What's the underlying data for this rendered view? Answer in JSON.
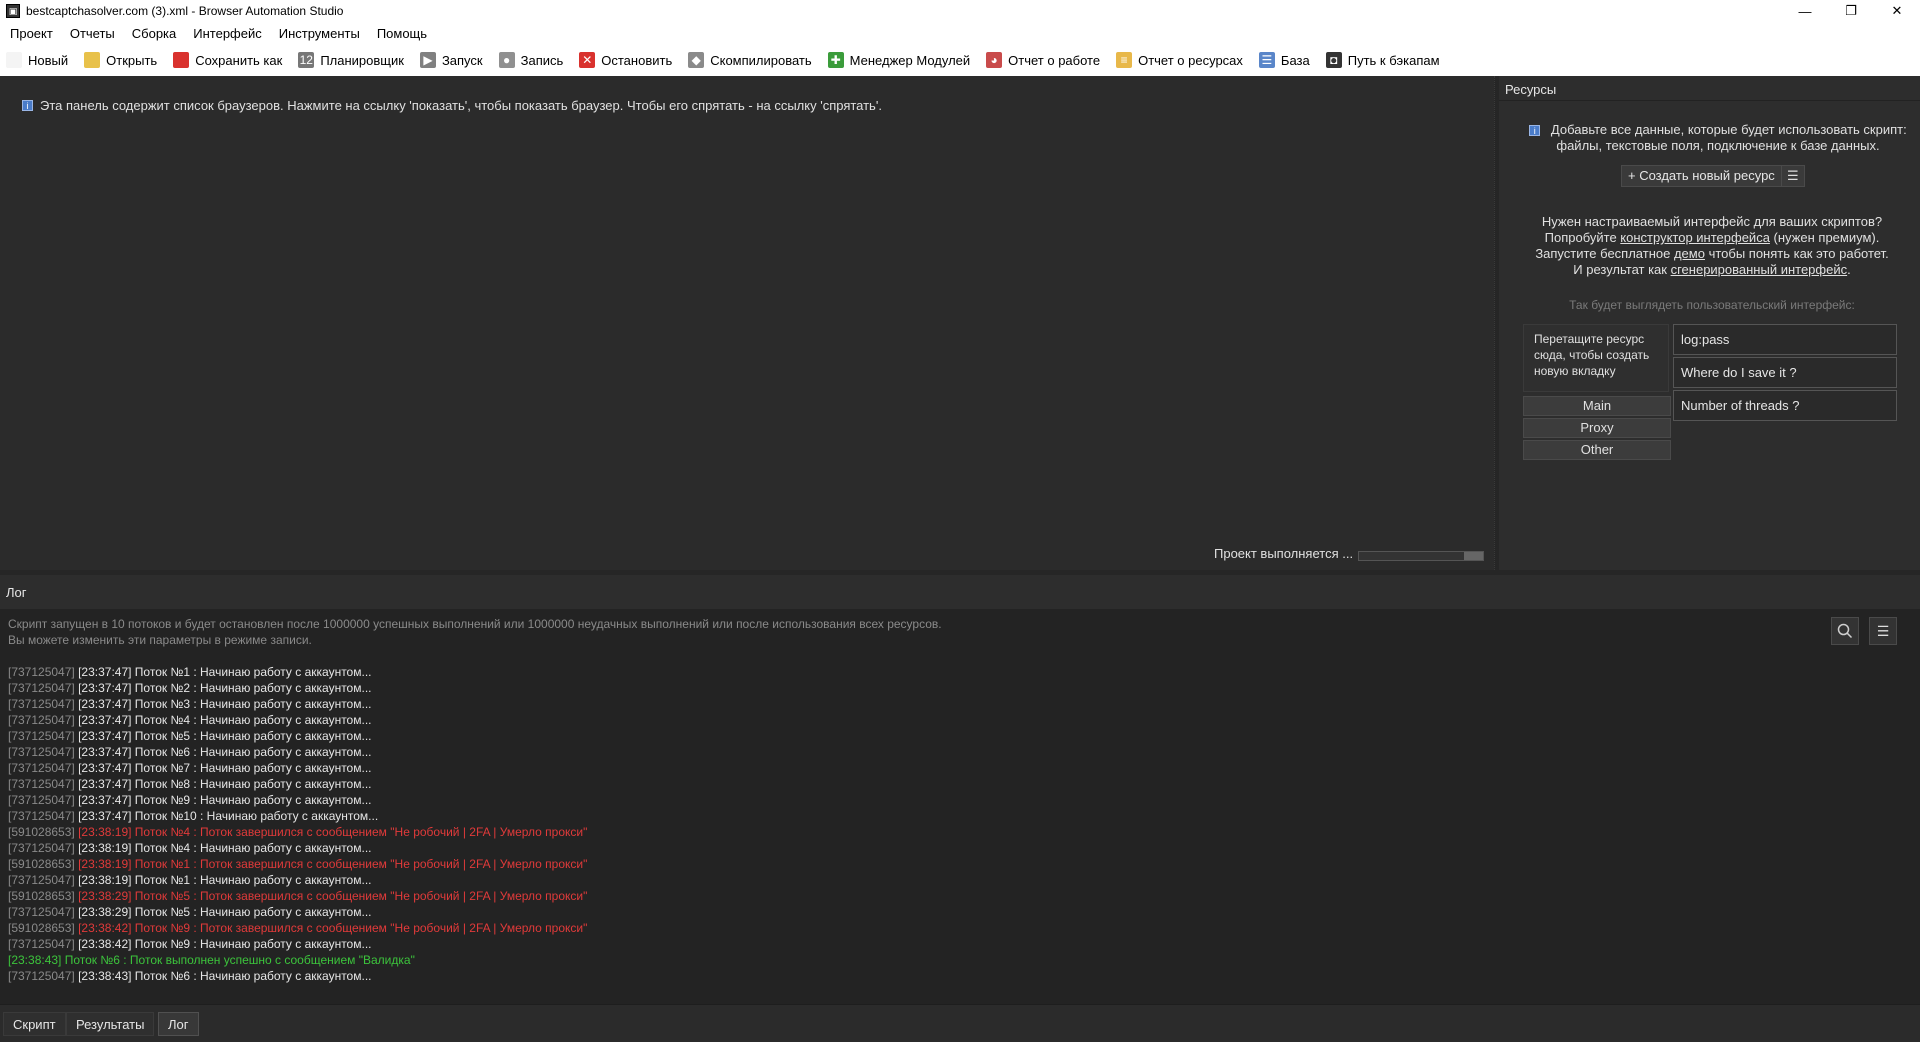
{
  "window": {
    "title": "bestcaptchasolver.com (3).xml - Browser Automation Studio",
    "controls": {
      "minimize": "—",
      "restore": "❐",
      "close": "✕"
    }
  },
  "menu": [
    "Проект",
    "Отчеты",
    "Сборка",
    "Интерфейс",
    "Инструменты",
    "Помощь"
  ],
  "toolbar": [
    {
      "label": "Новый",
      "icon": "new-file-icon",
      "glyph": "",
      "color": "#f4f4f4"
    },
    {
      "label": "Открыть",
      "icon": "folder-icon",
      "glyph": "",
      "color": "#e8c14a"
    },
    {
      "label": "Сохранить как",
      "icon": "save-icon",
      "glyph": "",
      "color": "#d9322e"
    },
    {
      "label": "Планировщик",
      "icon": "calendar-icon",
      "glyph": "12",
      "color": "#777777"
    },
    {
      "label": "Запуск",
      "icon": "play-icon",
      "glyph": "▶",
      "color": "#808080"
    },
    {
      "label": "Запись",
      "icon": "record-icon",
      "glyph": "●",
      "color": "#909090"
    },
    {
      "label": "Остановить",
      "icon": "stop-icon",
      "glyph": "✕",
      "color": "#d9322e"
    },
    {
      "label": "Скомпилировать",
      "icon": "compile-icon",
      "glyph": "◆",
      "color": "#8a8a8a"
    },
    {
      "label": "Менеджер Модулей",
      "icon": "puzzle-icon",
      "glyph": "✚",
      "color": "#3b9c3b"
    },
    {
      "label": "Отчет о работе",
      "icon": "pie-chart-icon",
      "glyph": "◕",
      "color": "#c94b4b"
    },
    {
      "label": "Отчет о ресурсах",
      "icon": "report-icon",
      "glyph": "≡",
      "color": "#e8b84a"
    },
    {
      "label": "База",
      "icon": "database-icon",
      "glyph": "☰",
      "color": "#5a86c9"
    },
    {
      "label": "Путь к бэкапам",
      "icon": "backup-icon",
      "glyph": "◘",
      "color": "#333333"
    }
  ],
  "main": {
    "info": "Эта панель содержит список браузеров. Нажмите на ссылку 'показать', чтобы показать браузер. Чтобы его спрятать - на ссылку 'спрятать'.",
    "status": "Проект выполняется ...",
    "progress": 0.15
  },
  "resources": {
    "header": "Ресурсы",
    "info_line1": "Добавьте все данные, которые будет использовать скрипт:",
    "info_line2": "файлы, текстовые поля, подключение к базе данных.",
    "create_button": "+ Создать новый ресурс",
    "promo_line1": "Нужен настраиваемый интерфейс для ваших скриптов?",
    "promo_line2_pre": "Попробуйте ",
    "promo_line2_link": "конструктор интерфейса",
    "promo_line2_post": " (нужен премиум).",
    "promo_line3_pre": "Запустите бесплатное ",
    "promo_line3_link": "демо",
    "promo_line3_post": " чтобы понять как это работет.",
    "promo_line4_pre": "И результат как ",
    "promo_line4_link": "сгенерированный интерфейс",
    "promo_line4_post": ".",
    "preview_caption": "Так будет выглядеть пользовательский интерфейс:",
    "drag_hint_1": "Перетащите ресурс",
    "drag_hint_2": "сюда, чтобы создать",
    "drag_hint_3": "новую вкладку",
    "tabs": [
      "Main",
      "Proxy",
      "Other"
    ],
    "fields": [
      "log:pass",
      "Where do I save it ?",
      "Number of threads ?"
    ]
  },
  "log": {
    "header": "Лог",
    "note_line1": "Скрипт запущен в 10 потоков и будет остановлен после 1000000 успешных выполнений или 1000000 неудачных выполнений или после использования всех ресурсов.",
    "note_line2": "Вы можете изменить эти параметры в режиме записи.",
    "lines": [
      {
        "id": "[737125047]",
        "text": "[23:37:47] Поток №1 : Начинаю работу с аккаунтом...",
        "kind": "norm"
      },
      {
        "id": "[737125047]",
        "text": "[23:37:47] Поток №2 : Начинаю работу с аккаунтом...",
        "kind": "norm"
      },
      {
        "id": "[737125047]",
        "text": "[23:37:47] Поток №3 : Начинаю работу с аккаунтом...",
        "kind": "norm"
      },
      {
        "id": "[737125047]",
        "text": "[23:37:47] Поток №4 : Начинаю работу с аккаунтом...",
        "kind": "norm"
      },
      {
        "id": "[737125047]",
        "text": "[23:37:47] Поток №5 : Начинаю работу с аккаунтом...",
        "kind": "norm"
      },
      {
        "id": "[737125047]",
        "text": "[23:37:47] Поток №6 : Начинаю работу с аккаунтом...",
        "kind": "norm"
      },
      {
        "id": "[737125047]",
        "text": "[23:37:47] Поток №7 : Начинаю работу с аккаунтом...",
        "kind": "norm"
      },
      {
        "id": "[737125047]",
        "text": "[23:37:47] Поток №8 : Начинаю работу с аккаунтом...",
        "kind": "norm"
      },
      {
        "id": "[737125047]",
        "text": "[23:37:47] Поток №9 : Начинаю работу с аккаунтом...",
        "kind": "norm"
      },
      {
        "id": "[737125047]",
        "text": "[23:37:47] Поток №10 : Начинаю работу с аккаунтом...",
        "kind": "norm"
      },
      {
        "id": "[591028653]",
        "text": "[23:38:19] Поток №4 : Поток завершился с сообщением \"Не робочий | 2FA | Умерло прокси\"",
        "kind": "err"
      },
      {
        "id": "[737125047]",
        "text": "[23:38:19] Поток №4 : Начинаю работу с аккаунтом...",
        "kind": "norm"
      },
      {
        "id": "[591028653]",
        "text": "[23:38:19] Поток №1 : Поток завершился с сообщением \"Не робочий | 2FA | Умерло прокси\"",
        "kind": "err"
      },
      {
        "id": "[737125047]",
        "text": "[23:38:19] Поток №1 : Начинаю работу с аккаунтом...",
        "kind": "norm"
      },
      {
        "id": "[591028653]",
        "text": "[23:38:29] Поток №5 : Поток завершился с сообщением \"Не робочий | 2FA | Умерло прокси\"",
        "kind": "err"
      },
      {
        "id": "[737125047]",
        "text": "[23:38:29] Поток №5 : Начинаю работу с аккаунтом...",
        "kind": "norm"
      },
      {
        "id": "[591028653]",
        "text": "[23:38:42] Поток №9 : Поток завершился с сообщением \"Не робочий | 2FA | Умерло прокси\"",
        "kind": "err"
      },
      {
        "id": "[737125047]",
        "text": "[23:38:42] Поток №9 : Начинаю работу с аккаунтом...",
        "kind": "norm"
      },
      {
        "id": "",
        "text": "[23:38:43] Поток №6 : Поток выполнен успешно с сообщением \"Валидка\"",
        "kind": "ok"
      },
      {
        "id": "[737125047]",
        "text": "[23:38:43] Поток №6 : Начинаю работу с аккаунтом...",
        "kind": "norm"
      }
    ]
  },
  "bottom_tabs": [
    "Скрипт",
    "Результаты",
    "Лог"
  ],
  "active_bottom_tab": "Лог"
}
